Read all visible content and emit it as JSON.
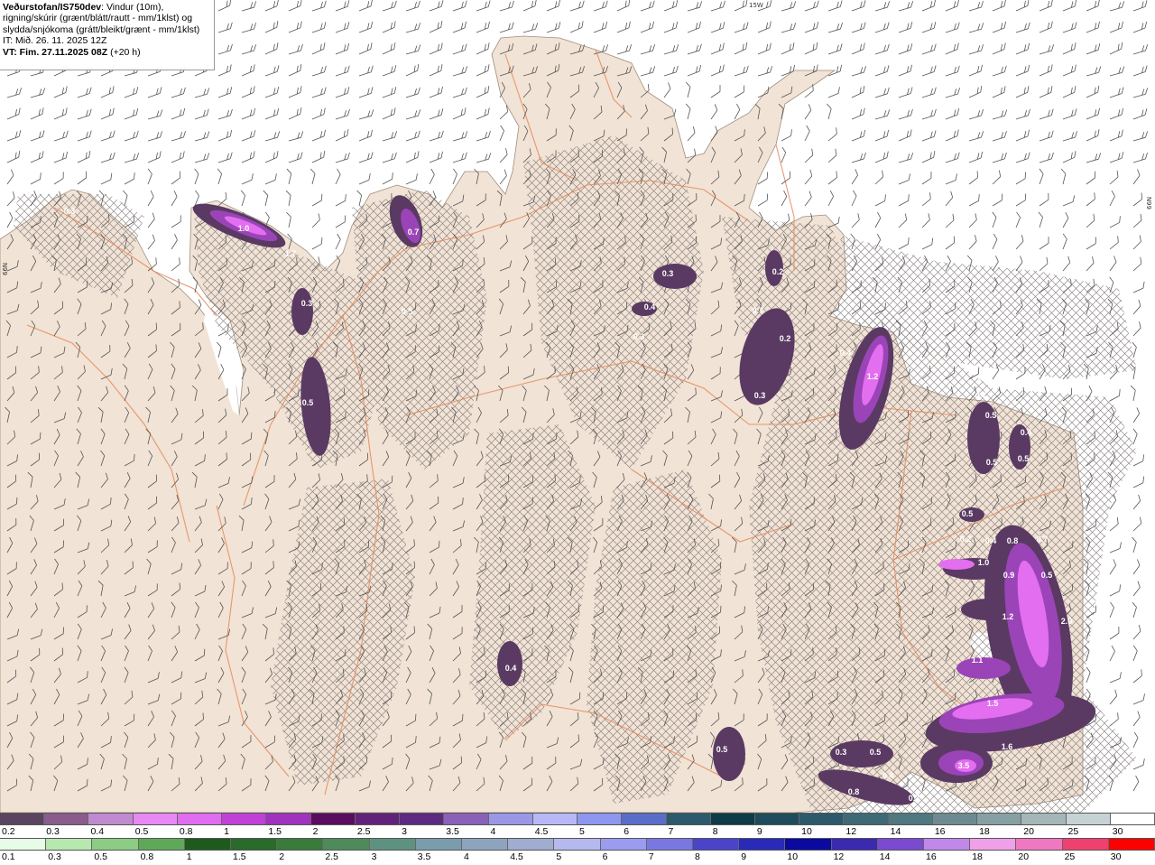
{
  "header": {
    "title_bold": "Veðurstofan/IS750dev",
    "title_rest": ": Vindur (10m),",
    "line2": "rigning/skúrir (grænt/blátt/rautt - mm/1klst) og",
    "line3": "slydda/snjókoma (grátt/bleikt/grænt - mm/1klst)",
    "line4": "IT: Mið. 26. 11. 2025 12Z",
    "line5_bold": "VT: Fim. 27.11.2025 08Z",
    "line5_rest": " (+20 h)"
  },
  "grid_labels": {
    "lon_15w": "15W",
    "lat_66n_left": "66N",
    "lat_66n_right": "66N"
  },
  "colors": {
    "land": "#f1e3d5",
    "sea": "#ffffff",
    "roads": "#e58a5c",
    "precip_light": "#5a3a62",
    "precip_mid": "#9a44b8",
    "precip_high": "#e36ef0"
  },
  "precip_labels": [
    "0.3",
    "1.0",
    "1.7",
    "0.7",
    "0.2",
    "0.3",
    "0.4",
    "0.3",
    "0.3",
    "0.5",
    "0.5",
    "0.7",
    "0.2",
    "0.3",
    "0.4",
    "1.2",
    "0.7",
    "0.5",
    "0.4",
    "0.5",
    "0.5",
    "0.5",
    "0.2",
    "0.4",
    "0.8",
    "0.7",
    "1.0",
    "0.9",
    "0.5",
    "1.2",
    "2.0",
    "1.1",
    "1.5",
    "0.3",
    "0.5",
    "0.4",
    "0.8",
    "0.7",
    "3.5",
    "1.6",
    "0.5",
    "0.4"
  ],
  "legend_snow": {
    "labels": [
      "0.2",
      "0.3",
      "0.4",
      "0.5",
      "0.8",
      "1",
      "1.5",
      "2",
      "2.5",
      "3",
      "3.5",
      "4",
      "4.5",
      "5",
      "6",
      "7",
      "8",
      "9",
      "10",
      "12",
      "14",
      "16",
      "18",
      "20",
      "25",
      "30"
    ],
    "colors": [
      "#5a4460",
      "#8a5c8c",
      "#c08ad0",
      "#e888f4",
      "#e06cf0",
      "#c040d8",
      "#a032c0",
      "#5a0c60",
      "#62227a",
      "#5c2a80",
      "#8a60b8",
      "#9a98e6",
      "#b8b8f8",
      "#8e96f0",
      "#5a6ec8",
      "#2a5a6c",
      "#0e3c48",
      "#1e4c5c",
      "#2c5a6a",
      "#3e6a78",
      "#507880",
      "#6c8a90",
      "#86a0a4",
      "#a4b6b8",
      "#c6d2d4",
      "#ffffff"
    ]
  },
  "legend_rain": {
    "labels": [
      "0.1",
      "0.3",
      "0.5",
      "0.8",
      "1",
      "1.5",
      "2",
      "2.5",
      "3",
      "3.5",
      "4",
      "4.5",
      "5",
      "6",
      "7",
      "8",
      "9",
      "10",
      "12",
      "14",
      "16",
      "18",
      "20",
      "25",
      "30"
    ],
    "colors": [
      "#e6fce6",
      "#b6e8b0",
      "#8ccc84",
      "#5ea85a",
      "#1e5a1e",
      "#2a6a2a",
      "#3a7a3a",
      "#4e8a5a",
      "#5e9280",
      "#7a9cac",
      "#8ea4be",
      "#a0acd0",
      "#b6b8f0",
      "#9a9cf0",
      "#7a78e0",
      "#4a44c8",
      "#2a2ab8",
      "#0a0aa0",
      "#3a2ab0",
      "#7a4ad0",
      "#c088e8",
      "#f0a0e8",
      "#f078c0",
      "#f04070",
      "#ff0000"
    ]
  }
}
